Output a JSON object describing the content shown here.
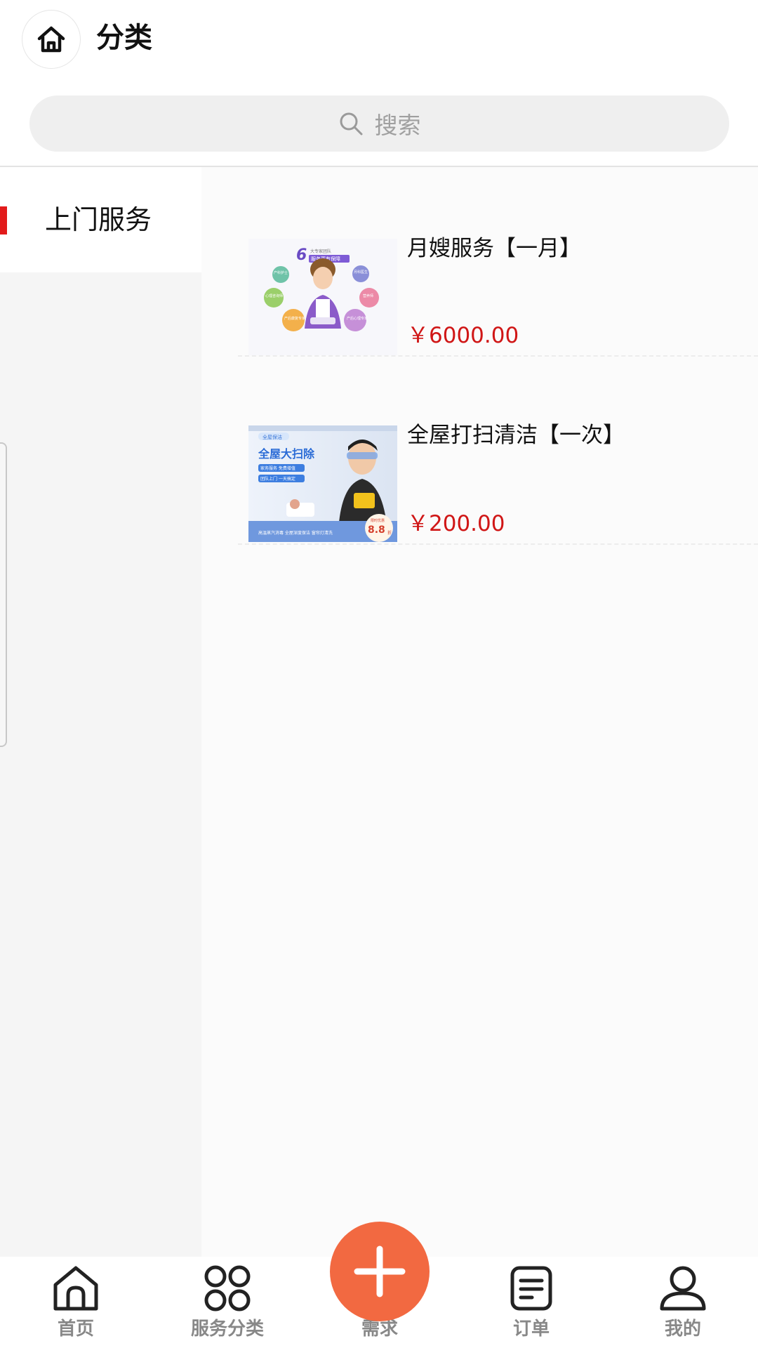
{
  "header": {
    "title": "分类"
  },
  "search": {
    "placeholder": "搜索"
  },
  "sidebar": {
    "items": [
      {
        "label": "上门服务",
        "active": true
      }
    ]
  },
  "products": [
    {
      "name": "月嫂服务【一月】",
      "price": "￥6000.00",
      "image": {
        "headline_num": "6",
        "headline_small": "大专家团队",
        "headline_sub": "服务更有保障",
        "bubbles": [
          "产科护士",
          "月科医生",
          "心理咨询师",
          "营养师",
          "产后康复专家",
          "产后心理专家"
        ]
      }
    },
    {
      "name": "全屋打扫清洁【一次】",
      "price": "￥200.00",
      "image": {
        "tag": "全屋保洁",
        "title": "全屋大扫除",
        "line1": "家务服务 免费增值",
        "line2": "团队上门 一天搞定",
        "bottom": "高温蒸汽消毒 全屋深度保洁 窗帘灯清洗",
        "badge_small": "限时优惠",
        "badge_num": "8.8",
        "badge_unit": "折"
      }
    }
  ],
  "bottom_nav": {
    "items": [
      {
        "label": "首页",
        "icon": "home-icon"
      },
      {
        "label": "服务分类",
        "icon": "grid-icon"
      },
      {
        "label": "需求",
        "icon": "plus-icon"
      },
      {
        "label": "订单",
        "icon": "order-icon"
      },
      {
        "label": "我的",
        "icon": "user-icon"
      }
    ]
  },
  "colors": {
    "accent_red": "#e21b1b",
    "price_red": "#d01616",
    "fab_orange": "#f26941",
    "nav_gray": "#888888"
  }
}
